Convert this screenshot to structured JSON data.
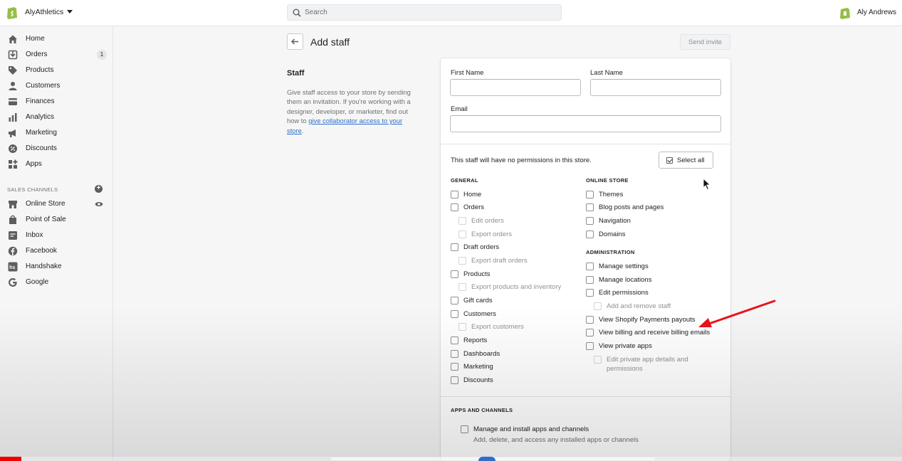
{
  "topbar": {
    "store_name": "AlyAthletics",
    "search_placeholder": "Search",
    "user_name": "Aly Andrews",
    "brand_color": "#95bf47"
  },
  "sidebar": {
    "items": [
      {
        "label": "Home",
        "icon": "home-icon"
      },
      {
        "label": "Orders",
        "icon": "orders-icon",
        "badge": "1"
      },
      {
        "label": "Products",
        "icon": "tag-icon"
      },
      {
        "label": "Customers",
        "icon": "person-icon"
      },
      {
        "label": "Finances",
        "icon": "finances-icon"
      },
      {
        "label": "Analytics",
        "icon": "bar-chart-icon"
      },
      {
        "label": "Marketing",
        "icon": "megaphone-icon"
      },
      {
        "label": "Discounts",
        "icon": "discount-icon"
      },
      {
        "label": "Apps",
        "icon": "apps-icon"
      }
    ],
    "channels_title": "SALES CHANNELS",
    "channels": [
      {
        "label": "Online Store",
        "icon": "store-icon"
      },
      {
        "label": "Point of Sale",
        "icon": "pos-icon"
      },
      {
        "label": "Inbox",
        "icon": "inbox-icon"
      },
      {
        "label": "Facebook",
        "icon": "facebook-icon"
      },
      {
        "label": "Handshake",
        "icon": "handshake-icon"
      },
      {
        "label": "Google",
        "icon": "google-icon"
      }
    ]
  },
  "page": {
    "title": "Add staff",
    "send_invite": "Send invite",
    "section_heading": "Staff",
    "desc_text": "Give staff access to your store by sending them an invitation. If you're working with a designer, developer, or marketer, find out how to ",
    "desc_link": "give collaborator access to your store",
    "desc_end": "."
  },
  "form": {
    "first_name_label": "First Name",
    "last_name_label": "Last Name",
    "email_label": "Email",
    "first_name_value": "",
    "last_name_value": "",
    "email_value": "",
    "permission_note": "This staff will have no permissions in this store.",
    "select_all": "Select all"
  },
  "permissions": {
    "general_title": "GENERAL",
    "general": [
      {
        "label": "Home",
        "sub": false
      },
      {
        "label": "Orders",
        "sub": false
      },
      {
        "label": "Edit orders",
        "sub": true
      },
      {
        "label": "Export orders",
        "sub": true
      },
      {
        "label": "Draft orders",
        "sub": false
      },
      {
        "label": "Export draft orders",
        "sub": true
      },
      {
        "label": "Products",
        "sub": false
      },
      {
        "label": "Export products and inventory",
        "sub": true
      },
      {
        "label": "Gift cards",
        "sub": false
      },
      {
        "label": "Customers",
        "sub": false
      },
      {
        "label": "Export customers",
        "sub": true
      },
      {
        "label": "Reports",
        "sub": false
      },
      {
        "label": "Dashboards",
        "sub": false
      },
      {
        "label": "Marketing",
        "sub": false
      },
      {
        "label": "Discounts",
        "sub": false
      }
    ],
    "online_store_title": "ONLINE STORE",
    "online_store": [
      {
        "label": "Themes"
      },
      {
        "label": "Blog posts and pages"
      },
      {
        "label": "Navigation"
      },
      {
        "label": "Domains"
      }
    ],
    "admin_title": "ADMINISTRATION",
    "admin": [
      {
        "label": "Manage settings",
        "sub": false
      },
      {
        "label": "Manage locations",
        "sub": false
      },
      {
        "label": "Edit permissions",
        "sub": false
      },
      {
        "label": "Add and remove staff",
        "sub": true
      },
      {
        "label": "View Shopify Payments payouts",
        "sub": false
      },
      {
        "label": "View billing and receive billing emails",
        "sub": false
      },
      {
        "label": "View private apps",
        "sub": false
      },
      {
        "label": "Edit private app details and",
        "sub": true
      },
      {
        "label": "permissions",
        "sub": true
      }
    ],
    "apps_title": "APPS AND CHANNELS",
    "apps_item": "Manage and install apps and channels",
    "apps_desc": "Add, delete, and access any installed apps or channels"
  },
  "video": {
    "progress": 0.024,
    "progress_color": "#ee0000"
  }
}
